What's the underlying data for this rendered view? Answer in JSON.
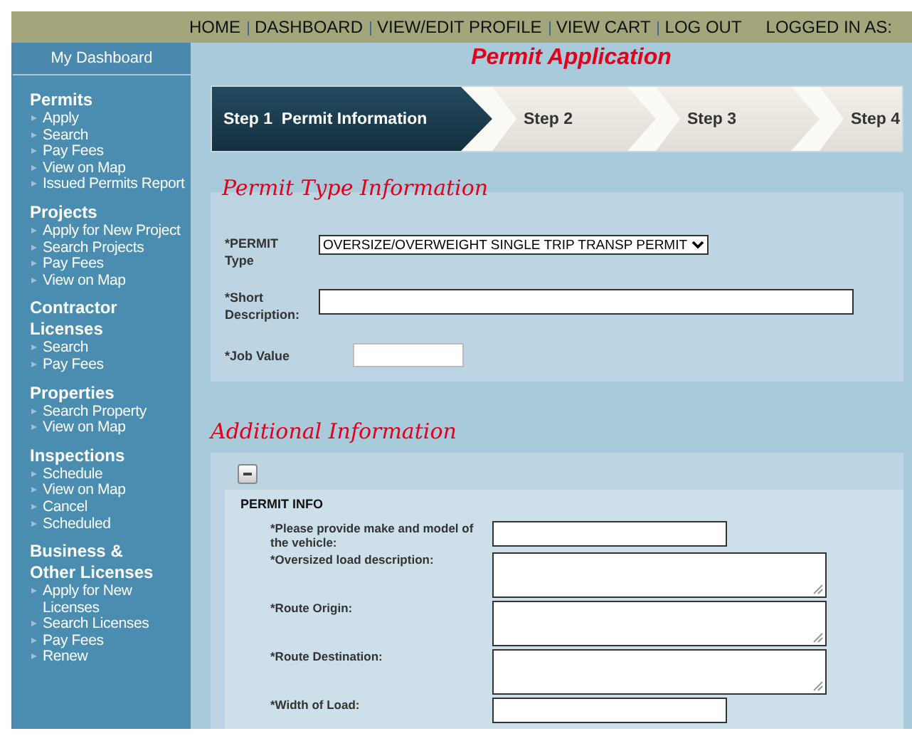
{
  "top_nav": {
    "links": [
      {
        "label": "HOME"
      },
      {
        "label": "DASHBOARD"
      },
      {
        "label": "VIEW/EDIT PROFILE"
      },
      {
        "label": "VIEW CART"
      },
      {
        "label": "LOG OUT"
      }
    ],
    "logged_in_label": "LOGGED IN AS:"
  },
  "sidebar": {
    "header": "My Dashboard",
    "sections": [
      {
        "title": "Permits",
        "items": [
          "Apply",
          "Search",
          "Pay Fees",
          "View on Map",
          "Issued Permits Report"
        ]
      },
      {
        "title": "Projects",
        "items": [
          "Apply for New Project",
          "Search Projects",
          "Pay Fees",
          "View on Map"
        ]
      },
      {
        "title": "Contractor Licenses",
        "items": [
          "Search",
          "Pay Fees"
        ]
      },
      {
        "title": "Properties",
        "items": [
          "Search Property",
          "View on Map"
        ]
      },
      {
        "title": "Inspections",
        "items": [
          "Schedule",
          "View on Map",
          "Cancel",
          "Scheduled"
        ]
      },
      {
        "title": "Business & Other Licenses",
        "items": [
          "Apply for New Licenses",
          "Search Licenses",
          "Pay Fees",
          "Renew"
        ]
      }
    ]
  },
  "page_title": "Permit Application",
  "steps": [
    {
      "number": "Step 1",
      "label": "Permit Information",
      "selected": true
    },
    {
      "number": "Step 2",
      "selected": false
    },
    {
      "number": "Step 3",
      "selected": false
    },
    {
      "number": "Step 4",
      "selected": false
    }
  ],
  "permit_type_section": {
    "title": "Permit Type Information",
    "fields": [
      {
        "label": "*PERMIT Type",
        "kind": "select",
        "value": "OVERSIZE/OVERWEIGHT SINGLE TRIP TRANSP PERMIT"
      },
      {
        "label": "*Short Description:",
        "kind": "text"
      },
      {
        "label": "*Job Value",
        "kind": "short"
      }
    ]
  },
  "additional_section": {
    "title": "Additional Information",
    "expanded": true,
    "group_title": "PERMIT INFO",
    "fields": [
      {
        "label": "*Please provide make and model of the vehicle:",
        "kind": "text"
      },
      {
        "label": "*Oversized load description:",
        "kind": "textarea"
      },
      {
        "label": "*Route Origin:",
        "kind": "textarea"
      },
      {
        "label": "*Route Destination:",
        "kind": "textarea"
      },
      {
        "label": "*Width of Load:",
        "kind": "text"
      }
    ]
  }
}
